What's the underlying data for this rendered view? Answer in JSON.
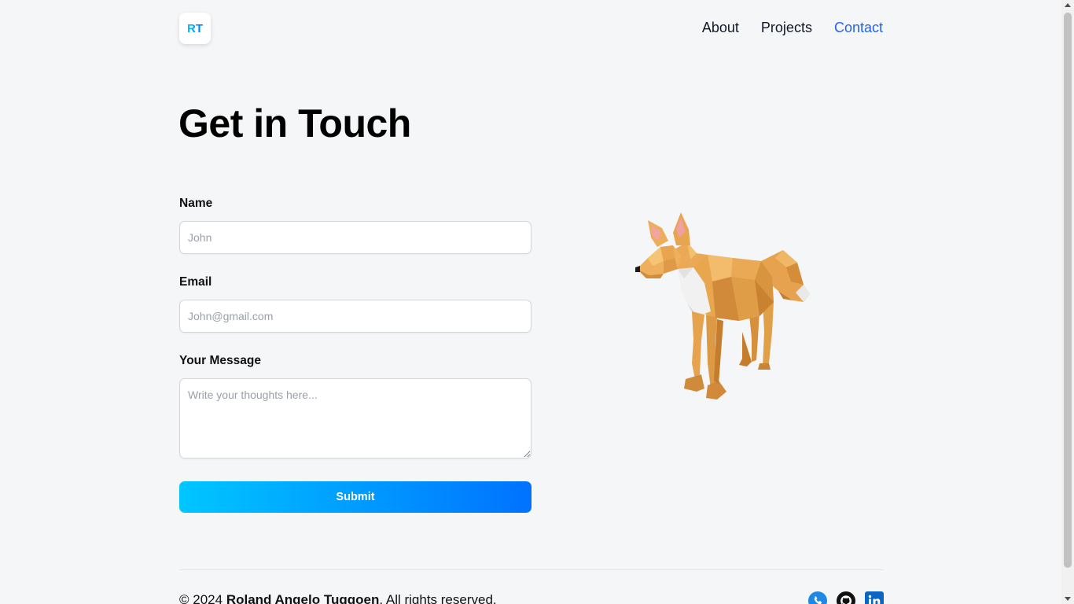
{
  "header": {
    "logo_text": "RT",
    "nav": [
      {
        "label": "About",
        "active": false
      },
      {
        "label": "Projects",
        "active": false
      },
      {
        "label": "Contact",
        "active": true
      }
    ]
  },
  "main": {
    "title": "Get in Touch",
    "form": {
      "name": {
        "label": "Name",
        "placeholder": "John",
        "value": ""
      },
      "email": {
        "label": "Email",
        "placeholder": "John@gmail.com",
        "value": ""
      },
      "message": {
        "label": "Your Message",
        "placeholder": "Write your thoughts here...",
        "value": ""
      },
      "submit_label": "Submit"
    },
    "illustration": "low-poly-fox"
  },
  "footer": {
    "copyright_prefix": "© 2024",
    "owner": "Roland Angelo Tuggoen",
    "rights": ". All rights reserved.",
    "socials": [
      {
        "name": "phone-icon"
      },
      {
        "name": "github-icon"
      },
      {
        "name": "linkedin-icon"
      }
    ]
  },
  "colors": {
    "accent": "#2563eb",
    "gradient_start": "#00c6ff",
    "gradient_end": "#0072ff",
    "background": "#f5f6f8"
  }
}
